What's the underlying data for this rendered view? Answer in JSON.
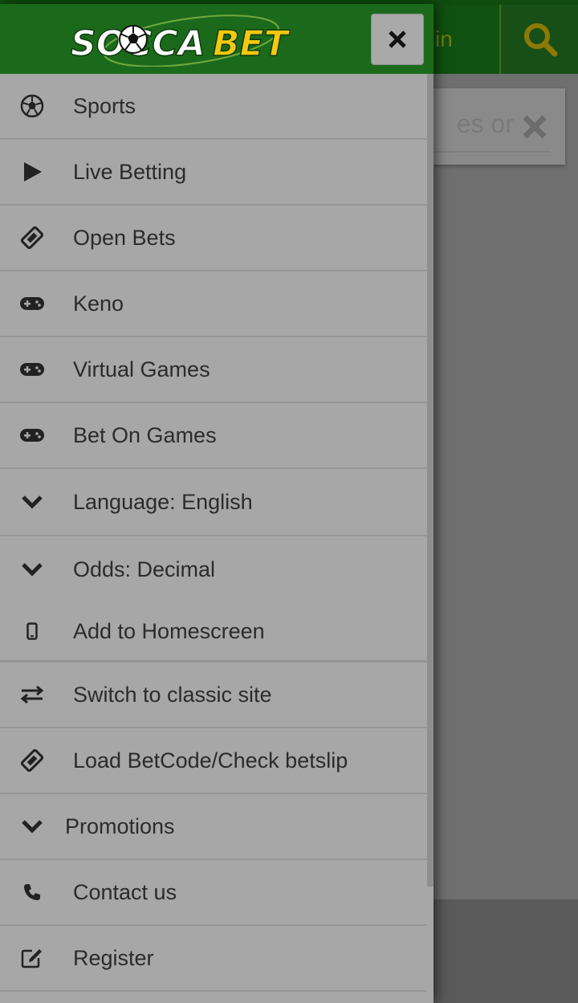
{
  "background": {
    "login_fragment": "in",
    "search_placeholder_fragment": "es or"
  },
  "drawer": {
    "logo": {
      "brand_part1": "SOCCA",
      "brand_part2": "BET"
    },
    "close_label": "×",
    "items": [
      {
        "label": "Sports",
        "icon": "soccer-ball-icon"
      },
      {
        "label": "Live Betting",
        "icon": "play-icon"
      },
      {
        "label": "Open Bets",
        "icon": "ticket-icon"
      },
      {
        "label": "Keno",
        "icon": "gamepad-icon"
      },
      {
        "label": "Virtual Games",
        "icon": "gamepad-icon"
      },
      {
        "label": "Bet On Games",
        "icon": "gamepad-icon"
      },
      {
        "label": "Language: English",
        "icon": "chevron-down-icon"
      },
      {
        "label": "Odds: Decimal",
        "icon": "chevron-down-icon"
      },
      {
        "label": "Add to Homescreen",
        "icon": "mobile-icon"
      },
      {
        "label": "Switch to classic site",
        "icon": "exchange-icon"
      },
      {
        "label": "Load BetCode/Check betslip",
        "icon": "ticket-icon"
      },
      {
        "label": "Promotions",
        "icon": "chevron-down-icon"
      },
      {
        "label": "Contact us",
        "icon": "phone-icon"
      },
      {
        "label": "Register",
        "icon": "edit-icon"
      }
    ]
  },
  "colors": {
    "header_green": "#1b6a1b",
    "logo_yellow": "#f2c811",
    "search_icon_yellow": "#b89a00"
  }
}
